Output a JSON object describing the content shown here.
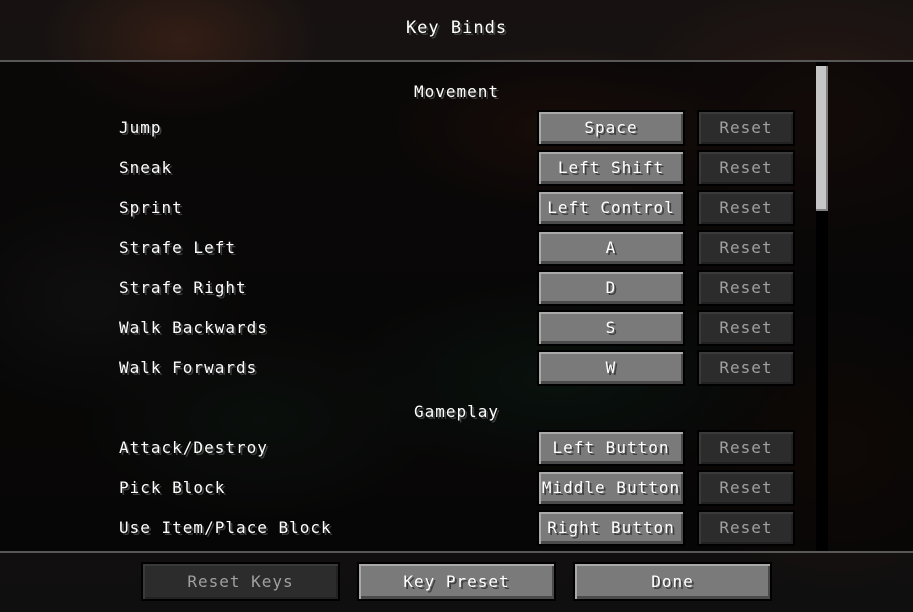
{
  "screen": {
    "title": "Key Binds"
  },
  "categories": [
    {
      "name": "Movement",
      "bindings": [
        {
          "action": "Jump",
          "key": "Space",
          "reset": "Reset"
        },
        {
          "action": "Sneak",
          "key": "Left Shift",
          "reset": "Reset"
        },
        {
          "action": "Sprint",
          "key": "Left Control",
          "reset": "Reset"
        },
        {
          "action": "Strafe Left",
          "key": "A",
          "reset": "Reset"
        },
        {
          "action": "Strafe Right",
          "key": "D",
          "reset": "Reset"
        },
        {
          "action": "Walk Backwards",
          "key": "S",
          "reset": "Reset"
        },
        {
          "action": "Walk Forwards",
          "key": "W",
          "reset": "Reset"
        }
      ]
    },
    {
      "name": "Gameplay",
      "bindings": [
        {
          "action": "Attack/Destroy",
          "key": "Left Button",
          "reset": "Reset"
        },
        {
          "action": "Pick Block",
          "key": "Middle Button",
          "reset": "Reset"
        },
        {
          "action": "Use Item/Place Block",
          "key": "Right Button",
          "reset": "Reset"
        }
      ]
    }
  ],
  "footer": {
    "reset_keys_label": "Reset Keys",
    "key_preset_label": "Key Preset",
    "done_label": "Done"
  },
  "colors": {
    "button_face": "#7a7a7a",
    "button_disabled": "#2c2c2c",
    "text": "#ffffff",
    "text_disabled": "#a0a0a0"
  }
}
